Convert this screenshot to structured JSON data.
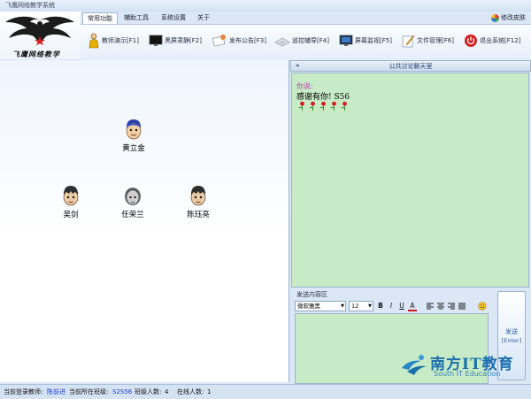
{
  "window": {
    "title": "飞鹰网络教学系统"
  },
  "logo": {
    "slogan": "飞鹰网络教学"
  },
  "menu": {
    "tabs": [
      "常用功能",
      "辅助工具",
      "系统设置",
      "关于"
    ],
    "active_index": 0,
    "skin_label": "修改皮肤"
  },
  "toolbar": {
    "items": [
      {
        "label": "教师演示[F1]",
        "icon": "teacher-icon"
      },
      {
        "label": "黑屏肃静[F2]",
        "icon": "monitor-black-icon"
      },
      {
        "label": "发布公告[F3]",
        "icon": "announcement-icon"
      },
      {
        "label": "遥控辅导[F4]",
        "icon": "remote-keyboard-icon"
      },
      {
        "label": "屏幕监视[F5]",
        "icon": "screen-monitor-icon"
      },
      {
        "label": "文件管理[F6]",
        "icon": "file-manager-icon"
      },
      {
        "label": "退出系统[F12]",
        "icon": "power-icon"
      }
    ]
  },
  "students": [
    {
      "name": "黄立金",
      "avatar": "student-avatar-blue-hat"
    },
    {
      "name": "吴剑",
      "avatar": "student-avatar"
    },
    {
      "name": "任荣兰",
      "avatar": "student-avatar-gray"
    },
    {
      "name": "陈珏亮",
      "avatar": "student-avatar"
    }
  ],
  "chat": {
    "header_arrow": "»",
    "title": "公共讨论聊天室",
    "messages": [
      {
        "sender": "你说:",
        "text": "感谢有你! S56",
        "emoji": "rose-icon",
        "emoji_count": 5
      }
    ]
  },
  "composer": {
    "label": "发送内容区",
    "font_name": "微软雅黑",
    "font_size": "12",
    "format_buttons": [
      "B",
      "I",
      "U",
      "A"
    ],
    "send_label": "发送",
    "send_shortcut": "[Enter]"
  },
  "watermark": {
    "cn": "南方IT教育",
    "en": "South IT Education"
  },
  "status": {
    "teacher_label": "当前登录教师:",
    "teacher_name": "陈前进",
    "class_label": "当前所在班级:",
    "class_name": "S2S56",
    "class_count_label": "班级人数:",
    "class_count": "4",
    "online_label": "在线人数:",
    "online_count": "1"
  },
  "colors": {
    "chat_bg": "#c7ebc6",
    "panel_bg": "#dbe7f5",
    "link_blue": "#1a3fd0",
    "sender_magenta": "#c03cc0"
  }
}
